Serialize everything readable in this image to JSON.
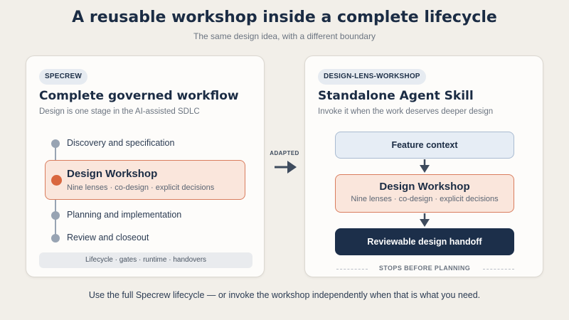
{
  "header": {
    "title": "A reusable workshop inside a complete lifecycle",
    "subtitle": "The same design idea, with a different boundary"
  },
  "left_card": {
    "tag": "SPECREW",
    "title": "Complete governed workflow",
    "subtitle": "Design is one stage in the AI-assisted SDLC",
    "steps": [
      {
        "label": "Discovery and specification"
      },
      {
        "label": "Design Workshop",
        "detail": "Nine lenses · co-design · explicit decisions",
        "highlighted": true
      },
      {
        "label": "Planning and implementation"
      },
      {
        "label": "Review and closeout"
      }
    ],
    "footer": "Lifecycle · gates · runtime · handovers"
  },
  "connector": {
    "label": "ADAPTED",
    "icon": "arrow-right-icon"
  },
  "right_card": {
    "tag": "DESIGN-LENS-WORKSHOP",
    "title": "Standalone Agent Skill",
    "subtitle": "Invoke it when the work deserves deeper design",
    "flow": {
      "context": "Feature context",
      "workshop_title": "Design Workshop",
      "workshop_detail": "Nine lenses · co-design · explicit decisions",
      "handoff": "Reviewable design handoff"
    },
    "boundary_note": "STOPS BEFORE PLANNING"
  },
  "footer_note": "Use the full Specrew lifecycle — or invoke the workshop independently when that is what you need.",
  "colors": {
    "background": "#f2efe9",
    "navy": "#1c2f4a",
    "accent_orange": "#d9673f",
    "highlight_fill": "#fae6dc",
    "context_fill": "#e6edf5",
    "timeline_gray": "#98a4b3"
  }
}
